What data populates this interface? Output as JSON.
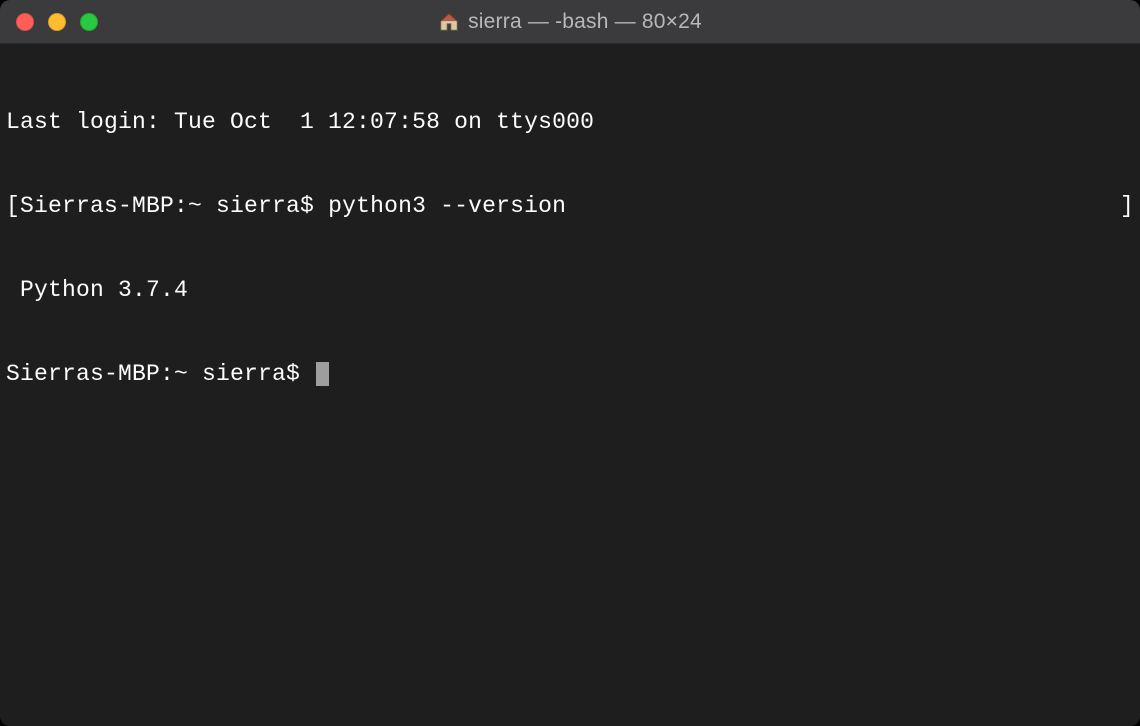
{
  "titlebar": {
    "icon_name": "home-icon",
    "title": "sierra — -bash — 80×24"
  },
  "terminal": {
    "line1": "Last login: Tue Oct  1 12:07:58 on ttys000",
    "prompt1_bracket_left": "[",
    "prompt1": "Sierras-MBP:~ sierra$ ",
    "command1": "python3 --version",
    "prompt1_bracket_right": "]",
    "output1": " Python 3.7.4",
    "prompt2": "Sierras-MBP:~ sierra$ "
  }
}
